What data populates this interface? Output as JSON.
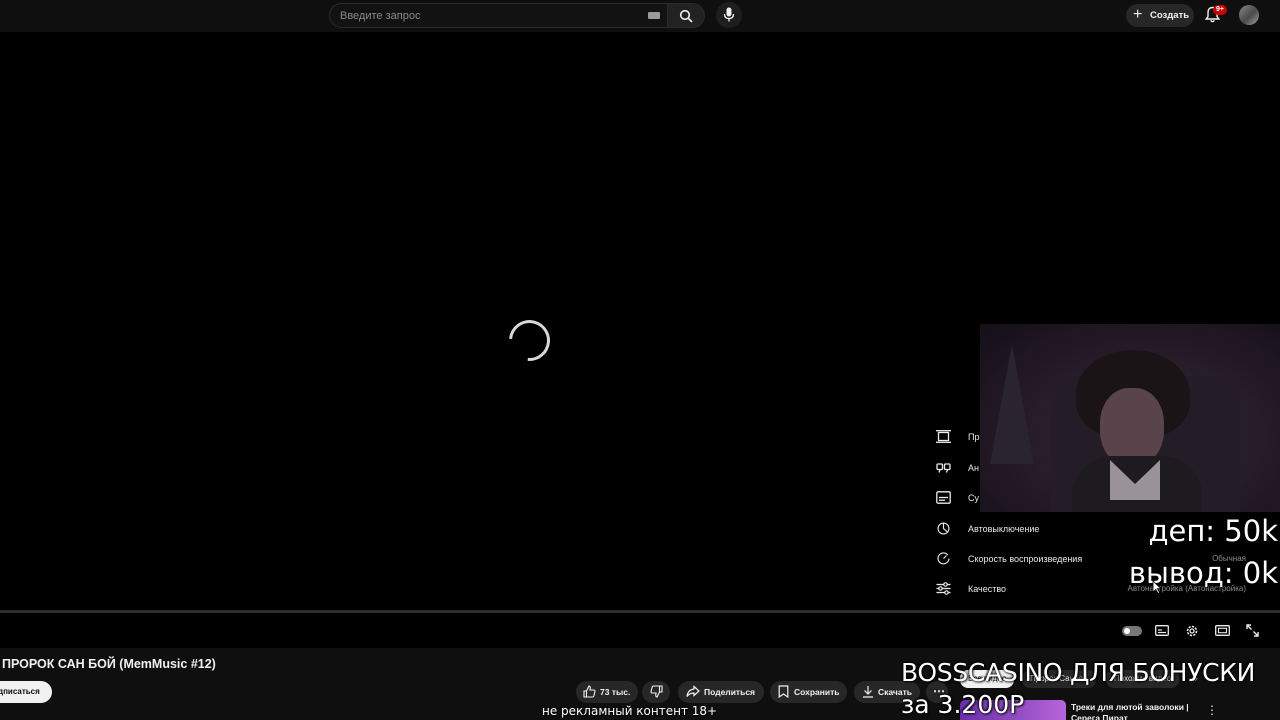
{
  "search": {
    "placeholder": "Введите запрос"
  },
  "header": {
    "create_label": "Создать",
    "notifications_badge": "9+"
  },
  "player": {
    "state": "loading",
    "settings_menu": [
      {
        "icon": "ambient-mode-icon",
        "label": "Пр",
        "value": ""
      },
      {
        "icon": "annotations-icon",
        "label": "Ан",
        "value": ""
      },
      {
        "icon": "subtitles-icon",
        "label": "Су",
        "value": ""
      },
      {
        "icon": "sleep-timer-icon",
        "label": "Автовыключение",
        "value": ""
      },
      {
        "icon": "playback-speed-icon",
        "label": "Скорость воспроизведения",
        "value": "Обычная"
      },
      {
        "icon": "quality-icon",
        "label": "Качество",
        "value": "Автонастройка (Автонастройка)"
      }
    ]
  },
  "overlay": {
    "deposit": "деп: 50k",
    "withdraw": "вывод: 0k",
    "promo_line1": "BOSSCASINO ДЛЯ БОНУСКИ",
    "promo_line2": "за 3.200Р",
    "disclaimer": "не рекламный контент 18+"
  },
  "video": {
    "title": "ПРОРОК САН БОЙ (MemMusic #12)",
    "subscribe_label": "дписаться",
    "likes": "73 тыс.",
    "share_label": "Поделиться",
    "save_label": "Сохранить",
    "download_label": "Скачать"
  },
  "recommendations": {
    "chips": [
      "Все видео",
      "Пророк Санбой",
      "Похожие видео"
    ],
    "first_title": "Треки для лютой заволоки | Серега Пират"
  }
}
